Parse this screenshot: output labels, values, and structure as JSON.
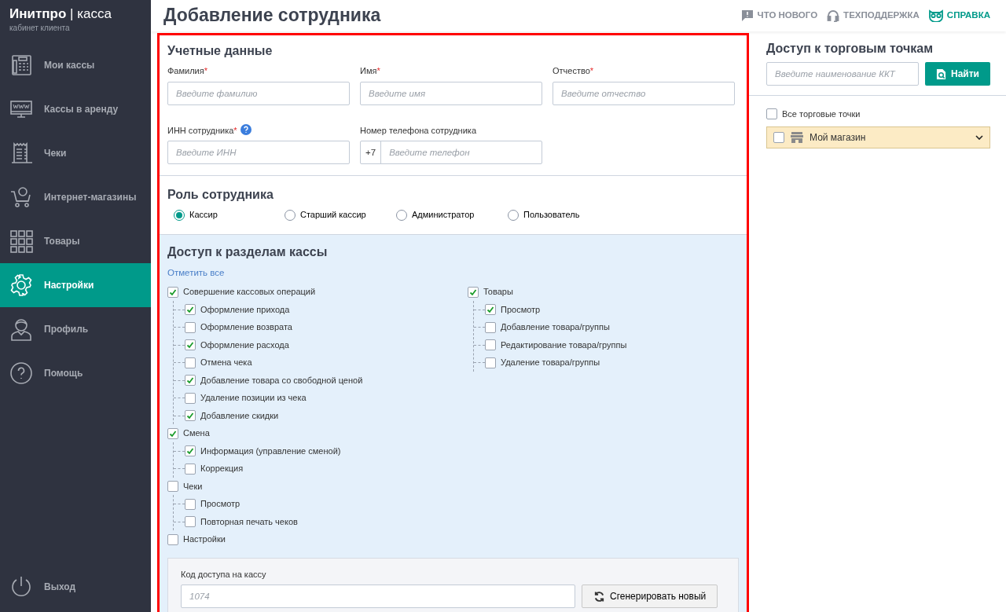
{
  "sidebar": {
    "brand": "Инитпро",
    "separator": "|",
    "product": "касса",
    "subtitle": "кабинет клиента",
    "items": [
      {
        "label": "Мои кассы",
        "selected": false
      },
      {
        "label": "Кассы в аренду",
        "selected": false
      },
      {
        "label": "Чеки",
        "selected": false
      },
      {
        "label": "Интернет-магазины",
        "selected": false
      },
      {
        "label": "Товары",
        "selected": false
      },
      {
        "label": "Настройки",
        "selected": true
      },
      {
        "label": "Профиль",
        "selected": false
      },
      {
        "label": "Помощь",
        "selected": false
      }
    ],
    "logout": "Выход"
  },
  "header": {
    "title": "Добавление сотрудника",
    "links": [
      {
        "label": "ЧТО НОВОГО",
        "kind": "plain"
      },
      {
        "label": "ТЕХПОДДЕРЖКА",
        "kind": "plain"
      },
      {
        "label": "СПРАВКА",
        "kind": "accent"
      }
    ]
  },
  "credentials": {
    "title": "Учетные данные",
    "fields": [
      {
        "label": "Фамилия",
        "required_mark": "*",
        "placeholder": "Введите фамилию"
      },
      {
        "label": "Имя",
        "required_mark": "*",
        "placeholder": "Введите имя"
      },
      {
        "label": "Отчество",
        "required_mark": "*",
        "placeholder": "Введите отчество"
      },
      {
        "label": "ИНН сотрудника",
        "required_mark": "*",
        "kind": "help",
        "placeholder": "Введите ИНН"
      },
      {
        "label": "Номер телефона сотрудника",
        "prefix": "+7",
        "placeholder": "Введите телефон"
      }
    ]
  },
  "role": {
    "title": "Роль сотрудника",
    "options": [
      {
        "label": "Кассир",
        "selected": true
      },
      {
        "label": "Старший кассир",
        "selected": false
      },
      {
        "label": "Администратор",
        "selected": false
      },
      {
        "label": "Пользователь",
        "selected": false
      }
    ]
  },
  "access": {
    "title": "Доступ к разделам кассы",
    "select_all": "Отметить все",
    "columns": [
      [
        {
          "label": "Совершение кассовых операций",
          "checked": true,
          "children": [
            {
              "label": "Оформление прихода",
              "checked": true
            },
            {
              "label": "Оформление возврата",
              "checked": false
            },
            {
              "label": "Оформление расхода",
              "checked": true
            },
            {
              "label": "Отмена чека",
              "checked": false
            },
            {
              "label": "Добавление товара со свободной ценой",
              "checked": true
            },
            {
              "label": "Удаление позиции из чека",
              "checked": false
            },
            {
              "label": "Добавление скидки",
              "checked": true
            }
          ]
        },
        {
          "label": "Смена",
          "checked": true,
          "children": [
            {
              "label": "Информация (управление сменой)",
              "checked": true
            },
            {
              "label": "Коррекция",
              "checked": false
            }
          ]
        },
        {
          "label": "Чеки",
          "checked": false,
          "children": [
            {
              "label": "Просмотр",
              "checked": false
            },
            {
              "label": "Повторная печать чеков",
              "checked": false
            }
          ]
        },
        {
          "label": "Настройки",
          "checked": false
        }
      ],
      [
        {
          "label": "Товары",
          "checked": true,
          "children": [
            {
              "label": "Просмотр",
              "checked": true
            },
            {
              "label": "Добавление товара/группы",
              "checked": false
            },
            {
              "label": "Редактирование товара/группы",
              "checked": false
            },
            {
              "label": "Удаление товара/группы",
              "checked": false
            }
          ]
        }
      ]
    ],
    "code": {
      "label": "Код доступа на кассу",
      "placeholder": "1074"
    },
    "generate_button": "Сгенерировать новый"
  },
  "outlets": {
    "title": "Доступ к торговым точкам",
    "search_placeholder": "Введите наименование ККТ",
    "search_button": "Найти",
    "all": {
      "label": "Все торговые точки",
      "checked": false
    },
    "items": [
      {
        "label": "Мой магазин",
        "checked": false
      }
    ]
  }
}
